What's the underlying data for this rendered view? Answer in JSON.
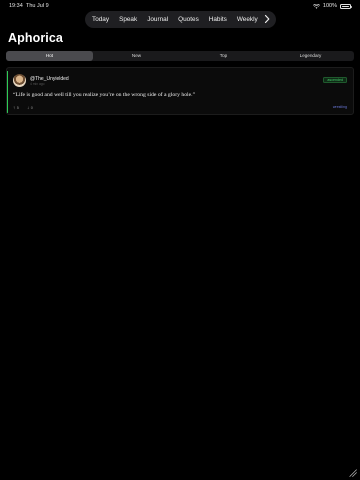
{
  "status_bar": {
    "time": "19:34",
    "date": "Thu Jul 9",
    "battery": "100%"
  },
  "nav": {
    "items": [
      "Today",
      "Speak",
      "Journal",
      "Quotes",
      "Habits",
      "Weekly"
    ],
    "more_icon": "chevron-right-icon"
  },
  "header": {
    "title": "Aphorica"
  },
  "tabs": [
    {
      "label": "Hot",
      "active": true
    },
    {
      "label": "New",
      "active": false
    },
    {
      "label": "Top",
      "active": false
    },
    {
      "label": "Legendary",
      "active": false
    }
  ],
  "post": {
    "username": "@The_Unyielded",
    "posted_when": "4 min ago",
    "badge": "ascended",
    "quote": "“Life is good and well till you realize you’re on the wrong side of a glory hole.”",
    "upvotes": "5",
    "downvotes": "0",
    "category": "wrestling",
    "accent_color": "#2ecc55"
  }
}
